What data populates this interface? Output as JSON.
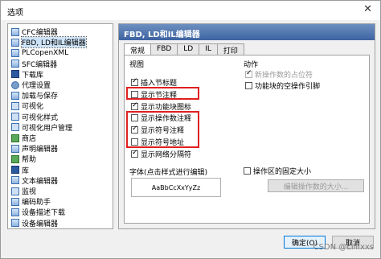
{
  "window": {
    "title": "选项",
    "close_glyph": "✕"
  },
  "tree": {
    "items": [
      {
        "label": "CFC编辑器",
        "icon": "document-icon"
      },
      {
        "label": "FBD, LD和IL编辑器",
        "icon": "document-icon",
        "selected": true
      },
      {
        "label": "PLCopenXML",
        "icon": "document-icon"
      },
      {
        "label": "SFC编辑器",
        "icon": "document-icon"
      },
      {
        "label": "下载库",
        "icon": "book-icon"
      },
      {
        "label": "代理设置",
        "icon": "gear-icon"
      },
      {
        "label": "加载与保存",
        "icon": "document-icon"
      },
      {
        "label": "可视化",
        "icon": "monitor-icon"
      },
      {
        "label": "可视化样式",
        "icon": "monitor-icon"
      },
      {
        "label": "可视化用户管理",
        "icon": "monitor-icon"
      },
      {
        "label": "商店",
        "icon": "store-icon"
      },
      {
        "label": "声明编辑器",
        "icon": "document-icon"
      },
      {
        "label": "帮助",
        "icon": "help-icon"
      },
      {
        "label": "库",
        "icon": "book-icon"
      },
      {
        "label": "文本编辑器",
        "icon": "document-icon"
      },
      {
        "label": "监视",
        "icon": "monitor-icon"
      },
      {
        "label": "编码助手",
        "icon": "document-icon"
      },
      {
        "label": "设备描述下载",
        "icon": "document-icon"
      },
      {
        "label": "设备编辑器",
        "icon": "document-icon"
      }
    ]
  },
  "panel": {
    "header": "FBD, LD和IL编辑器",
    "tabs": [
      "常规",
      "FBD",
      "LD",
      "IL",
      "打印"
    ],
    "view_group_label": "视图",
    "view_options": [
      {
        "label": "插入节标题",
        "checked": true
      },
      {
        "label": "显示节注释",
        "checked": false
      },
      {
        "label": "显示功能块图标",
        "checked": true
      },
      {
        "label": "显示操作数注释",
        "checked": false
      },
      {
        "label": "显示符号注释",
        "checked": true
      },
      {
        "label": "显示符号地址",
        "checked": false
      },
      {
        "label": "显示网络分隔符",
        "checked": true
      }
    ],
    "action_group_label": "动作",
    "action_options": [
      {
        "label": "新操作数的占位符",
        "checked": true,
        "disabled": true
      },
      {
        "label": "功能块的空操作引脚",
        "checked": false,
        "disabled": false
      }
    ],
    "font_label": "字体(点击样式进行编辑)",
    "font_sample": "AaBbCcXxYyZz",
    "fixed_size_label": "操作区的固定大小",
    "edit_size_button": "编辑操作数的大小..."
  },
  "buttons": {
    "ok": "确定(O)",
    "cancel": "取消"
  },
  "watermark": "CSDN @Lillixxs"
}
